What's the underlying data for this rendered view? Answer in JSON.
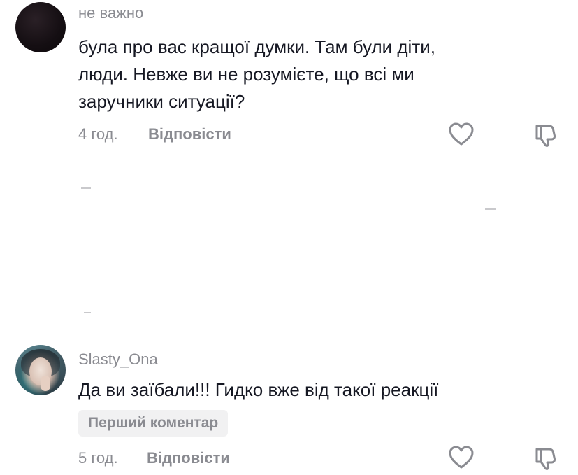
{
  "comments": [
    {
      "username": "не важно",
      "text_lines": [
        "була про вас кращої думки. Там були діти,",
        "люди. Невже ви не розумієте, що всі ми",
        "заручники ситуації?"
      ],
      "time": "4 год.",
      "reply_label": "Відповісти",
      "icons": {
        "avatar": "avatar",
        "like": "heart-icon",
        "dislike": "thumbs-down-icon"
      }
    },
    {
      "username": "Slasty_Ona",
      "text_lines": [
        "Да ви заїбали!!! Гидко вже від такої реакції"
      ],
      "badge": "Перший коментар",
      "time": "5 год.",
      "reply_label": "Відповісти",
      "icons": {
        "avatar": "avatar",
        "like": "heart-icon",
        "dislike": "thumbs-down-icon"
      }
    }
  ],
  "colors": {
    "text": "#161823",
    "muted": "#8a8b91",
    "badge_bg": "#f1f1f2"
  }
}
